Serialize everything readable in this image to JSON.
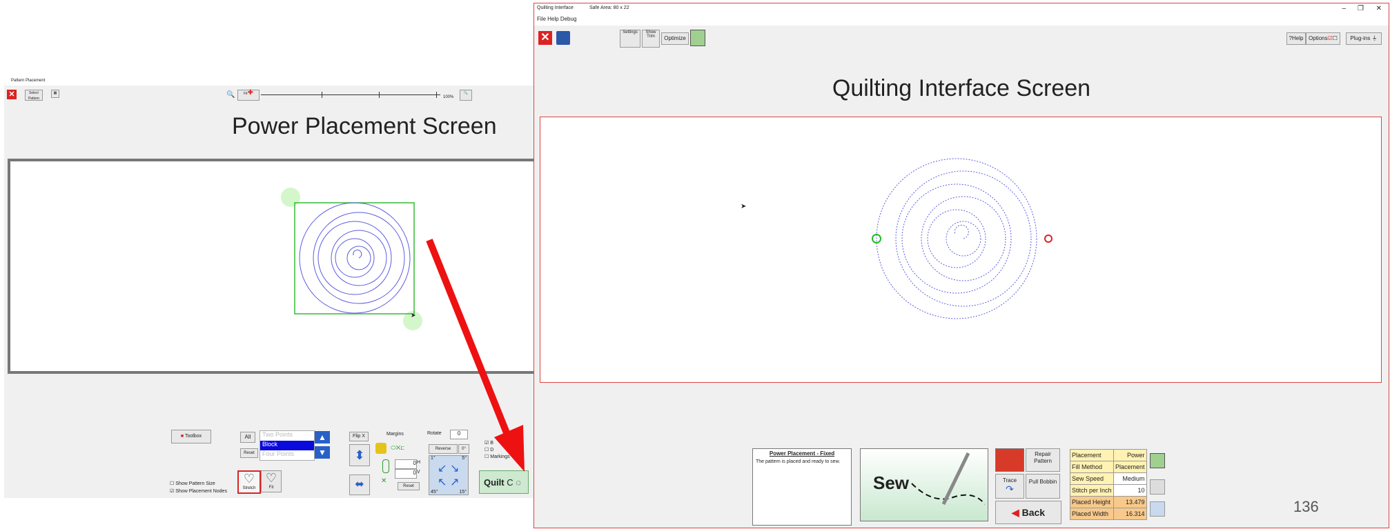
{
  "left_window": {
    "title": "Pattern Placement",
    "toolbar": {
      "select_pattern_label": "Select Pattern",
      "zoom_fit_label": "Fit",
      "zoom_pct_label": "100%"
    },
    "heading": "Power Placement Screen",
    "bottom": {
      "toolbox_label": "Toolbox",
      "all_label": "All",
      "reset_label": "Reset",
      "placement_options": [
        "Two Points",
        "Block",
        "Four Points"
      ],
      "selected_option": "Block",
      "flip_label": "Flip X",
      "margins_label": "Margins",
      "rotate_label": "Rotate",
      "rotate_value": "0",
      "reverse_label": "Reverse",
      "zero_deg_label": "0°",
      "h_value": "0",
      "h_label": "H",
      "v_value": "0",
      "v_label": "V",
      "reset2_label": "Reset",
      "angle_1": "1°",
      "angle_5": "5°",
      "angle_45": "45°",
      "angle_15": "15°",
      "checkbox_1": "B",
      "checkbox_2": "D",
      "checkbox_3": "Markings",
      "show_pattern_size": "Show Pattern Size",
      "show_placement_nodes": "Show Placement Nodes",
      "stretch_label": "Stretch",
      "fit_label": "Fit",
      "quilt_label": "Quilt"
    }
  },
  "right_window": {
    "title": "Quilting Interface",
    "safe_area": "Safe Area: 80 x 22",
    "menu": [
      "File",
      "Help",
      "Debug"
    ],
    "toolbar": {
      "settings_label": "Settings",
      "show_trim_label": "Show Trim",
      "optimize_label": "Optimize",
      "help_label": "Help",
      "options_label": "Options",
      "plugins_label": "Plug-ins"
    },
    "heading": "Quilting Interface Screen",
    "status": {
      "title": "Power Placement - Fixed",
      "message": "The pattern is placed and ready to sew."
    },
    "sew_label": "Sew",
    "repair_pattern_label": "Repair Pattern",
    "trace_label": "Trace",
    "pull_bobbin_label": "Pull Bobbin",
    "back_label": "Back",
    "settings_table": [
      {
        "label": "Placement",
        "value": "Power"
      },
      {
        "label": "Fill Method",
        "value": "Placement"
      },
      {
        "label": "Sew Speed",
        "value": "Medium"
      },
      {
        "label": "Stitch per Inch",
        "value": "10"
      },
      {
        "label": "Placed Height",
        "value": "13.479"
      },
      {
        "label": "Placed Width",
        "value": "16.314"
      }
    ]
  },
  "page_number": "136",
  "colors": {
    "arrow": "#ee1111",
    "spiral": "#5c5ce0",
    "bounding_box": "#33bb33",
    "start_point": "#22bb22",
    "end_point": "#dd2222"
  }
}
